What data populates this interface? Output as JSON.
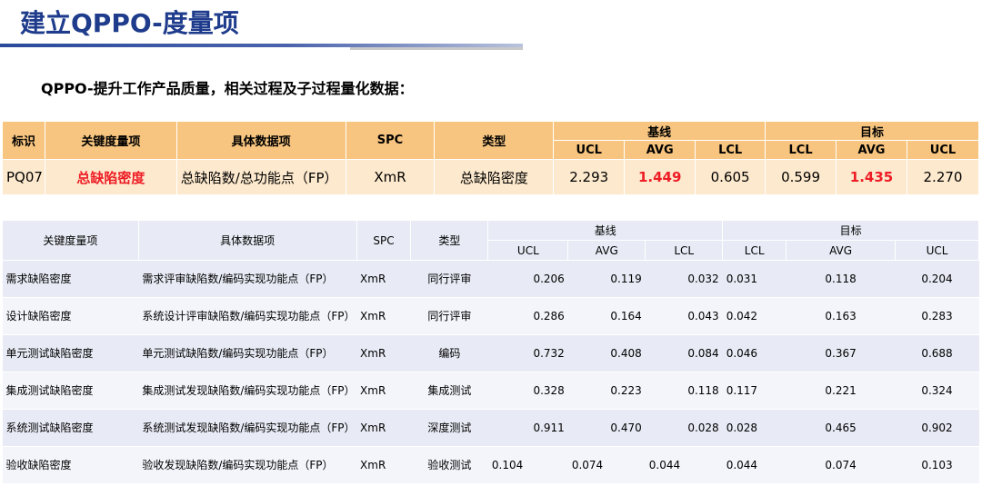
{
  "title": "建立QPPO-度量项",
  "subtitle": "QPPO-提升工作产品质量，相关过程及子过程量化数据：",
  "table1": {
    "headers": {
      "id": "标识",
      "key_metric": "关键度量项",
      "data_item": "具体数据项",
      "spc": "SPC",
      "type": "类型",
      "baseline": "基线",
      "target": "目标",
      "ucl": "UCL",
      "avg": "AVG",
      "lcl": "LCL"
    },
    "row": {
      "id": "PQ07",
      "key_metric": "总缺陷密度",
      "data_item": "总缺陷数/总功能点（FP）",
      "spc": "XmR",
      "type": "总缺陷密度",
      "b_ucl": "2.293",
      "b_avg": "1.449",
      "b_lcl": "0.605",
      "t_lcl": "0.599",
      "t_avg": "1.435",
      "t_ucl": "2.270"
    }
  },
  "table2": {
    "headers": {
      "key_metric": "关键度量项",
      "data_item": "具体数据项",
      "spc": "SPC",
      "type": "类型",
      "baseline": "基线",
      "target": "目标",
      "ucl": "UCL",
      "avg": "AVG",
      "lcl": "LCL"
    },
    "rows": [
      {
        "name": "需求缺陷密度",
        "item": "需求评审缺陷数/编码实现功能点（FP）",
        "spc": "XmR",
        "type": "同行评审",
        "b_ucl": "0.206",
        "b_avg": "0.119",
        "b_lcl": "0.032",
        "t_lcl": "0.031",
        "t_avg": "0.118",
        "t_ucl": "0.204"
      },
      {
        "name": "设计缺陷密度",
        "item": "系统设计评审缺陷数/编码实现功能点（FP）",
        "spc": "XmR",
        "type": "同行评审",
        "b_ucl": "0.286",
        "b_avg": "0.164",
        "b_lcl": "0.043",
        "t_lcl": "0.042",
        "t_avg": "0.163",
        "t_ucl": "0.283"
      },
      {
        "name": "单元测试缺陷密度",
        "item": "单元测试缺陷数/编码实现功能点（FP）",
        "spc": "XmR",
        "type": "编码",
        "b_ucl": "0.732",
        "b_avg": "0.408",
        "b_lcl": "0.084",
        "t_lcl": "0.046",
        "t_avg": "0.367",
        "t_ucl": "0.688"
      },
      {
        "name": "集成测试缺陷密度",
        "item": "集成测试发现缺陷数/编码实现功能点（FP）",
        "spc": "XmR",
        "type": "集成测试",
        "b_ucl": "0.328",
        "b_avg": "0.223",
        "b_lcl": "0.118",
        "t_lcl": "0.117",
        "t_avg": "0.221",
        "t_ucl": "0.324"
      },
      {
        "name": "系统测试缺陷密度",
        "item": "系统测试发现缺陷数/编码实现功能点（FP）",
        "spc": "XmR",
        "type": "深度测试",
        "b_ucl": "0.911",
        "b_avg": "0.470",
        "b_lcl": "0.028",
        "t_lcl": "0.028",
        "t_avg": "0.465",
        "t_ucl": "0.902"
      },
      {
        "name": "验收缺陷密度",
        "item": "验收发现缺陷数/编码实现功能点（FP）",
        "spc": "XmR",
        "type": "验收测试",
        "b_ucl": "0.104",
        "b_avg": "0.074",
        "b_lcl": "0.044",
        "t_lcl": "0.044",
        "t_avg": "0.074",
        "t_ucl": "0.103"
      }
    ]
  }
}
